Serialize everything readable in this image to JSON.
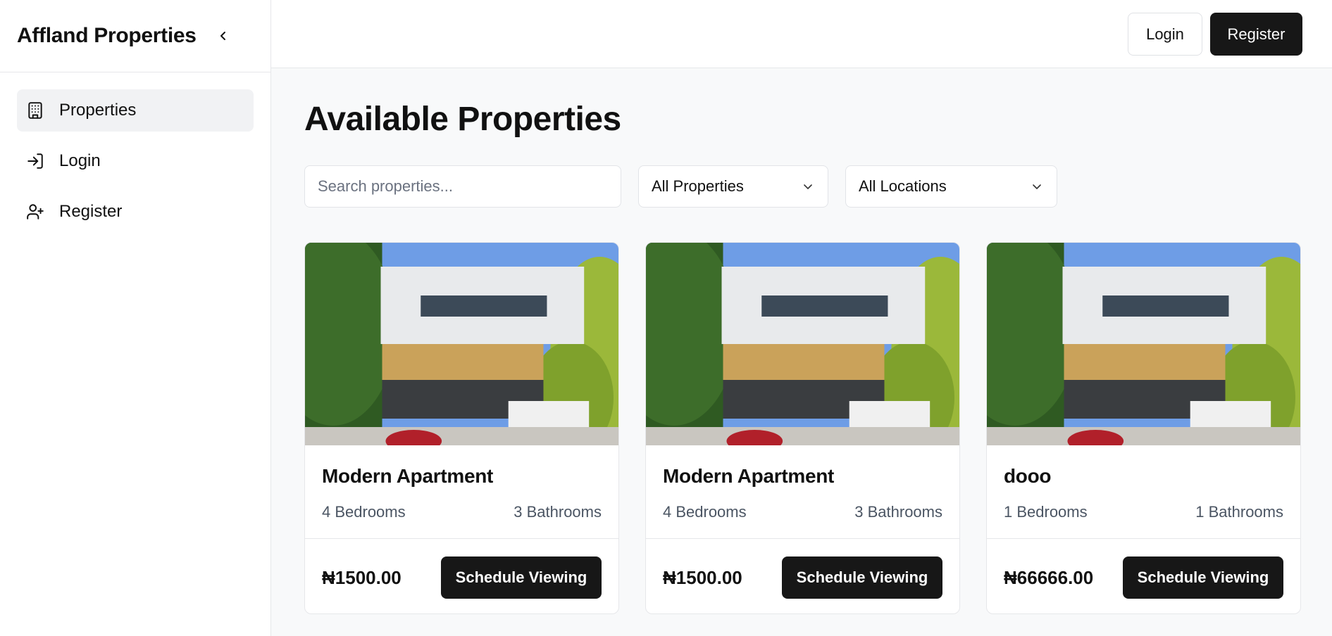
{
  "sidebar": {
    "brand": "Affland Properties",
    "items": [
      {
        "label": "Properties",
        "icon": "building-icon",
        "active": true
      },
      {
        "label": "Login",
        "icon": "login-icon",
        "active": false
      },
      {
        "label": "Register",
        "icon": "user-plus-icon",
        "active": false
      }
    ]
  },
  "header": {
    "login_label": "Login",
    "register_label": "Register"
  },
  "main": {
    "title": "Available Properties",
    "search_placeholder": "Search properties...",
    "type_filter": "All Properties",
    "location_filter": "All Locations",
    "properties": [
      {
        "title": "Modern Apartment",
        "bedrooms": "4 Bedrooms",
        "bathrooms": "3 Bathrooms",
        "price": "₦1500.00",
        "button": "Schedule Viewing"
      },
      {
        "title": "Modern Apartment",
        "bedrooms": "4 Bedrooms",
        "bathrooms": "3 Bathrooms",
        "price": "₦1500.00",
        "button": "Schedule Viewing"
      },
      {
        "title": "dooo",
        "bedrooms": "1 Bedrooms",
        "bathrooms": "1 Bathrooms",
        "price": "₦66666.00",
        "button": "Schedule Viewing"
      }
    ]
  },
  "colors": {
    "primary_button": "#171717",
    "active_nav_bg": "#f1f2f4",
    "page_bg": "#f8f9fa"
  }
}
